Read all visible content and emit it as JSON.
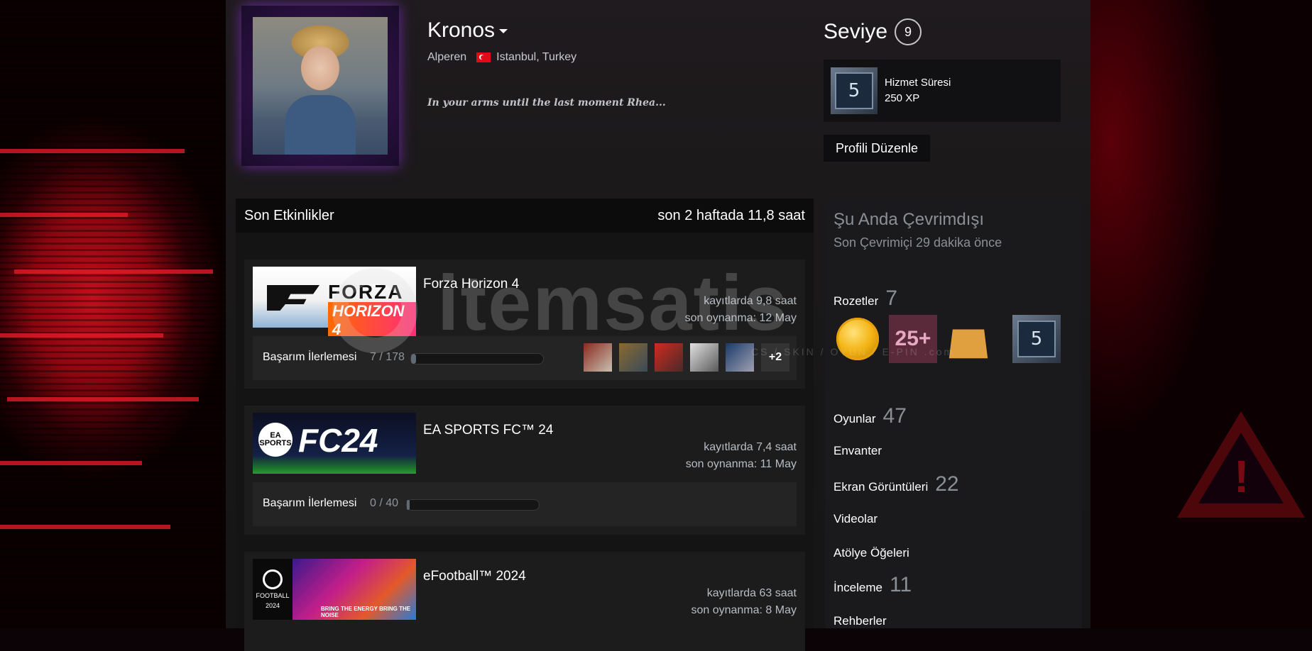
{
  "profile": {
    "name": "Kronos",
    "real_name": "Alperen",
    "location": "Istanbul, Turkey",
    "summary": "In your arms until the last moment Rhea..."
  },
  "level": {
    "label": "Seviye",
    "value": "9",
    "badge_name": "Hizmet Süresi",
    "badge_xp": "250 XP",
    "badge_number": "5"
  },
  "edit_button": "Profili Düzenle",
  "recent": {
    "title": "Son Etkinlikler",
    "hours_summary": "son 2 haftada 11,8 saat",
    "games": [
      {
        "name": "Forza Horizon 4",
        "cap_line1": "FORZA",
        "cap_line2": "HORIZON 4",
        "hours": "kayıtlarda 9,8 saat",
        "last_played": "son oynanma: 12 May",
        "ach_label": "Başarım İlerlemesi",
        "ach_count": "7 / 178",
        "ach_progress": 0.039,
        "ach_more": "+2"
      },
      {
        "name": "EA SPORTS FC™ 24",
        "cap_ea": "EA SPORTS",
        "cap_title": "FC24",
        "hours": "kayıtlarda 7,4 saat",
        "last_played": "son oynanma: 11 May",
        "ach_label": "Başarım İlerlemesi",
        "ach_count": "0 / 40",
        "ach_progress": 0
      },
      {
        "name": "eFootball™ 2024",
        "cap_logo": "FOOTBALL",
        "cap_year": "2024",
        "cap_tagline": "BRING THE ENERGY BRING THE NOISE",
        "hours": "kayıtlarda 63 saat",
        "last_played": "son oynanma: 8 May"
      }
    ]
  },
  "sidebar": {
    "status": "Şu Anda Çevrimdışı",
    "last_online": "Son Çevrimiçi 29 dakika önce",
    "badges_label": "Rozetler",
    "badges_count": "7",
    "badge_25": "25+",
    "badge_lvl": "5",
    "links": [
      {
        "label": "Oyunlar",
        "count": "47"
      },
      {
        "label": "Envanter",
        "count": ""
      },
      {
        "label": "Ekran Görüntüleri",
        "count": "22"
      },
      {
        "label": "Videolar",
        "count": ""
      },
      {
        "label": "Atölye Öğeleri",
        "count": ""
      },
      {
        "label": "İnceleme",
        "count": "11"
      },
      {
        "label": "Rehberler",
        "count": ""
      }
    ]
  },
  "watermark": {
    "text": "itemsatis",
    "sub": "CS / SKIN / OYUN / E-PIN .com"
  },
  "colors": {
    "accent_red": "#c0101c",
    "panel_dark": "#0c0c0c",
    "muted_text": "#8a8f96"
  }
}
